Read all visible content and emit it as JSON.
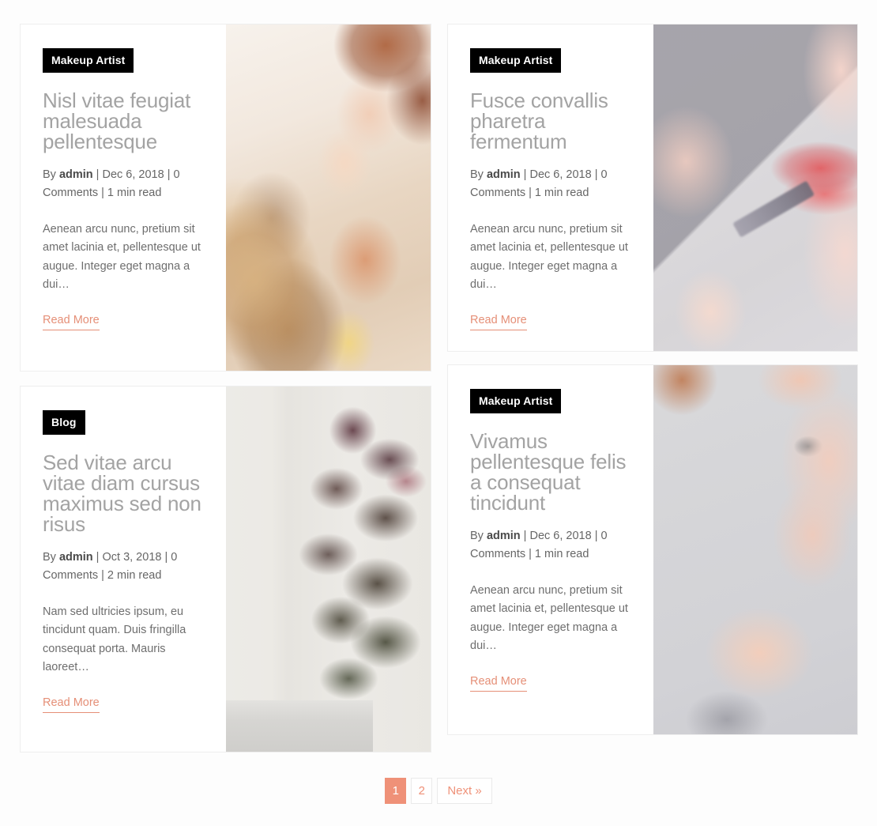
{
  "theme": {
    "accent": "#ef9178",
    "badge_bg": "#000000",
    "title_color": "#a3a3a3",
    "page_bg": "#fdfdfd",
    "card_bg": "#ffffff",
    "card_border": "#eeeeee"
  },
  "posts": [
    {
      "category": "Makeup Artist",
      "title": "Nisl vitae feugiat malesuada pellentesque",
      "meta": "By admin | Dec 6, 2018 | 0 Comments | 1 min read",
      "meta_by": "By ",
      "meta_author": "admin",
      "meta_rest": " | Dec 6, 2018 | 0 Comments | 1 min read",
      "excerpt": "Aenean arcu nunc, pretium sit amet lacinia et, pellentesque ut augue. Integer eget magna a dui…",
      "read_more": "Read More",
      "image_alt": "makeup artist styling a woman's curly updo hair"
    },
    {
      "category": "Makeup Artist",
      "title": "Fusce convallis pharetra fermentum",
      "meta": "By admin | Dec 6, 2018 | 0 Comments | 1 min read",
      "meta_by": "By ",
      "meta_author": "admin",
      "meta_rest": " | Dec 6, 2018 | 0 Comments | 1 min read",
      "excerpt": "Aenean arcu nunc, pretium sit amet lacinia et, pellentesque ut augue. Integer eget magna a dui…",
      "read_more": "Read More",
      "image_alt": "close-up of lipstick being applied with a brush"
    },
    {
      "category": "Blog",
      "title": "Sed vitae arcu vitae diam cursus maximus sed non risus",
      "meta": "By admin | Oct 3, 2018 | 0 Comments | 2 min read",
      "meta_by": "By ",
      "meta_author": "admin",
      "meta_rest": " | Oct 3, 2018 | 0 Comments | 2 min read",
      "excerpt": "Nam sed ultricies ipsum, eu tincidunt quam. Duis fringilla consequat porta. Mauris laoreet…",
      "read_more": "Read More",
      "image_alt": "japanese maple tree in front of a white wall"
    },
    {
      "category": "Makeup Artist",
      "title": "Vivamus pellentesque felis a consequat tincidunt",
      "meta": "By admin | Dec 6, 2018 | 0 Comments | 1 min read",
      "meta_by": "By ",
      "meta_author": "admin",
      "meta_rest": " | Dec 6, 2018 | 0 Comments | 1 min read",
      "excerpt": "Aenean arcu nunc, pretium sit amet lacinia et, pellentesque ut augue. Integer eget magna a dui…",
      "read_more": "Read More",
      "image_alt": "woman's face during eye makeup application"
    }
  ],
  "pagination": {
    "current": "1",
    "page_two": "2",
    "next": "Next »"
  }
}
